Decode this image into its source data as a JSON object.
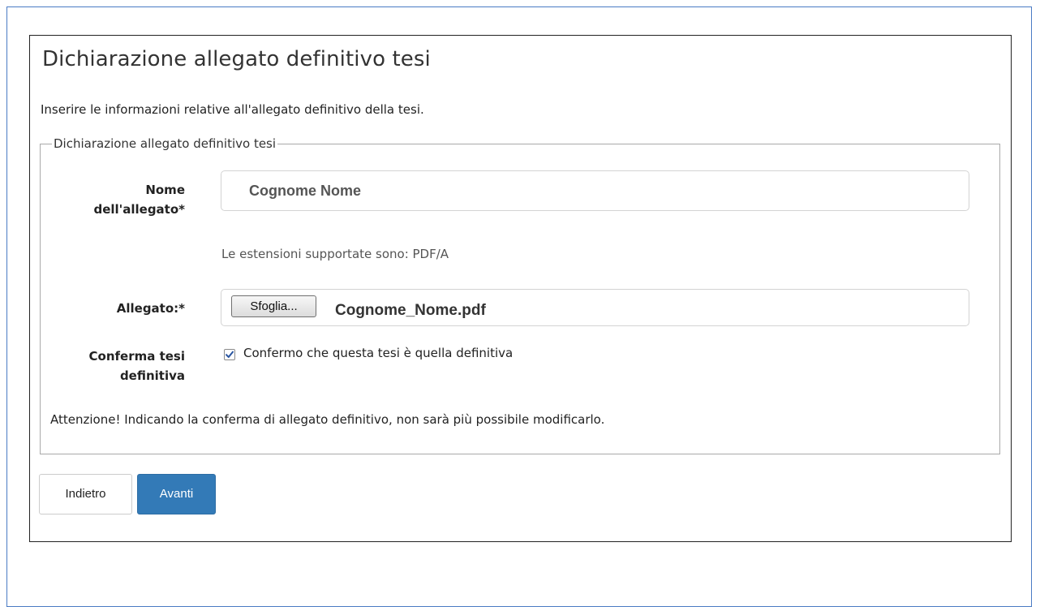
{
  "page": {
    "title": "Dichiarazione allegato definitivo tesi",
    "intro": "Inserire le informazioni relative all'allegato definitivo della tesi."
  },
  "form": {
    "legend": "Dichiarazione allegato definitivo tesi",
    "nome_label_line1": "Nome",
    "nome_label_line2": "dell'allegato*",
    "nome_value": "Cognome Nome",
    "hint": "Le estensioni supportate sono: PDF/A",
    "allegato_label": "Allegato:*",
    "browse_label": "Sfoglia...",
    "file_name": "Cognome_Nome.pdf",
    "conferma_label_line1": "Conferma tesi",
    "conferma_label_line2": "definitiva",
    "conferma_checked": true,
    "conferma_text": "Confermo che questa tesi è quella definitiva",
    "warning": "Attenzione! Indicando la conferma di allegato definitivo, non sarà più possibile modificarlo."
  },
  "actions": {
    "back_label": "Indietro",
    "next_label": "Avanti"
  },
  "colors": {
    "primary": "#337ab7",
    "frame_border": "#4a7bc4"
  }
}
